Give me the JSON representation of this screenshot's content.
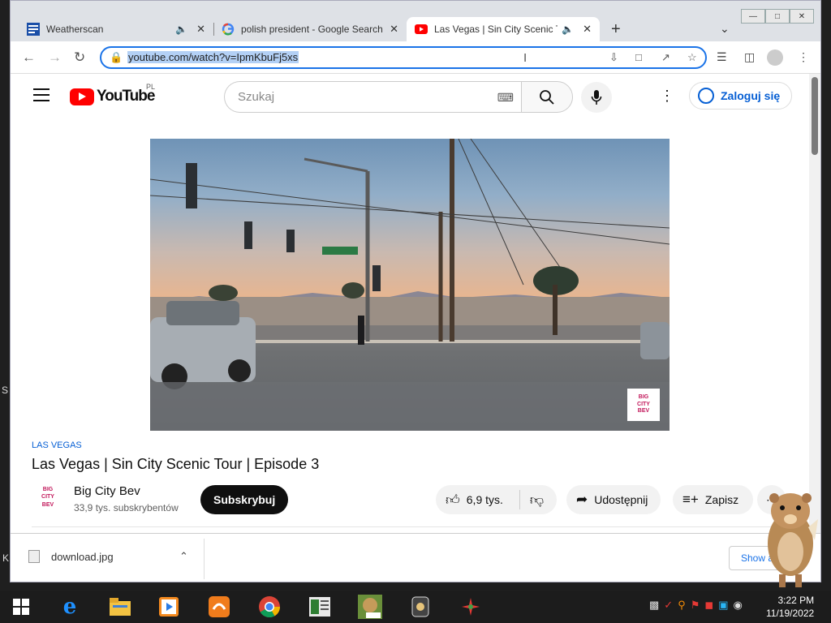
{
  "browser": {
    "tabs": [
      {
        "title": "Weatherscan",
        "icon": "weather-channel-icon"
      },
      {
        "title": "polish president - Google Search",
        "icon": "google-icon"
      },
      {
        "title": "Las Vegas | Sin City Scenic To",
        "icon": "youtube-icon"
      }
    ],
    "url": "youtube.com/watch?v=IpmKbuFj5xs"
  },
  "youtube": {
    "logo_text": "YouTube",
    "country": "PL",
    "search_placeholder": "Szukaj",
    "signin_label": "Zaloguj się",
    "video_watermark": [
      "BIG",
      "CITY",
      "BEV"
    ],
    "hashtag": "LAS VEGAS",
    "title": "Las Vegas | Sin City Scenic Tour | Episode 3",
    "channel": {
      "name": "Big City Bev",
      "subscribers": "33,9 tys. subskrybentów",
      "avatar_text": [
        "BIG",
        "CITY",
        "BEV"
      ]
    },
    "subscribe_label": "Subskrybuj",
    "likes": "6,9 tys.",
    "share_label": "Udostępnij",
    "save_label": "Zapisz"
  },
  "downloads": {
    "file": "download.jpg",
    "show_all": "Show all"
  },
  "edge_letters": {
    "s": "S",
    "k": "K"
  },
  "taskbar": {
    "time": "3:22 PM",
    "date": "11/19/2022"
  }
}
